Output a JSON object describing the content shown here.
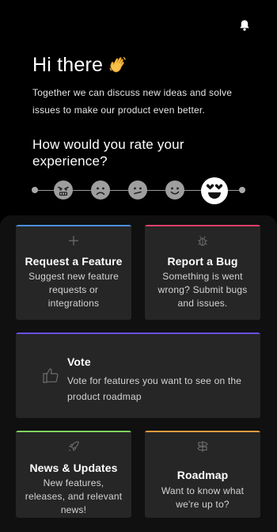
{
  "colors": {
    "background": "#000000",
    "panel": "#101010",
    "card": "#262626",
    "feature_accent": "#4a90d9",
    "bug_accent": "#e0406a",
    "vote_accent": "#6a4ee0",
    "news_accent": "#7fd35e",
    "roadmap_accent": "#e89a3c"
  },
  "header": {
    "greeting": "Hi there",
    "subtitle": "Together we can discuss new ideas and solve issues to make our product even better."
  },
  "rating": {
    "question": "How would you rate your experience?",
    "options": [
      "angry",
      "sad",
      "confused",
      "happy",
      "love"
    ],
    "selected": "love"
  },
  "cards": {
    "request": {
      "title": "Request a Feature",
      "description": "Suggest new feature requests or integrations",
      "icon": "plus-icon"
    },
    "bug": {
      "title": "Report a Bug",
      "description": "Something is went wrong? Submit bugs and issues.",
      "icon": "bug-icon"
    },
    "vote": {
      "title": "Vote",
      "description": "Vote for features you want to see on the product roadmap",
      "icon": "thumbs-up-icon"
    },
    "news": {
      "title": "News & Updates",
      "description": "New features, releases, and relevant news!",
      "icon": "rocket-icon"
    },
    "roadmap": {
      "title": "Roadmap",
      "description": "Want to know what we're up to?",
      "icon": "signpost-icon"
    }
  }
}
